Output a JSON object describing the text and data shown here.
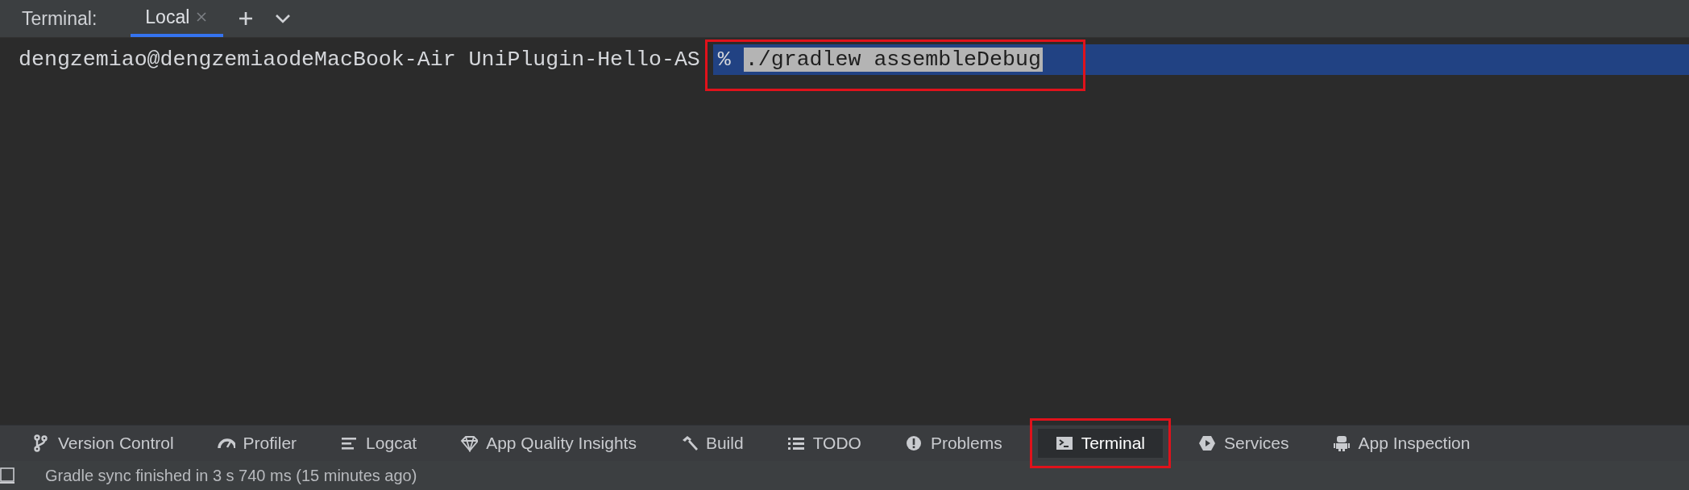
{
  "tool_window": {
    "title": "Terminal:",
    "tabs": [
      {
        "label": "Local",
        "selected": true
      }
    ]
  },
  "terminal": {
    "lines": [
      {
        "prompt": "dengzemiao@dengzemiaodeMacBook-Air UniPlugin-Hello-AS",
        "symbol": "%",
        "command": "./gradlew assembleDebug",
        "current": true,
        "command_selected": true,
        "annotated": true
      }
    ]
  },
  "toolbar": {
    "items": [
      {
        "label": "Version Control",
        "kind": "branch",
        "selected": false,
        "annotated": false
      },
      {
        "label": "Profiler",
        "kind": "gauge",
        "selected": false,
        "annotated": false
      },
      {
        "label": "Logcat",
        "kind": "lines",
        "selected": false,
        "annotated": false
      },
      {
        "label": "App Quality Insights",
        "kind": "diamond",
        "selected": false,
        "annotated": false
      },
      {
        "label": "Build",
        "kind": "hammer",
        "selected": false,
        "annotated": false
      },
      {
        "label": "TODO",
        "kind": "list",
        "selected": false,
        "annotated": false
      },
      {
        "label": "Problems",
        "kind": "alert",
        "selected": false,
        "annotated": false
      },
      {
        "label": "Terminal",
        "kind": "terminal",
        "selected": true,
        "annotated": true
      },
      {
        "label": "Services",
        "kind": "play",
        "selected": false,
        "annotated": false
      },
      {
        "label": "App Inspection",
        "kind": "robot",
        "selected": false,
        "annotated": false
      }
    ]
  },
  "status_bar": {
    "text": "Gradle sync finished in 3 s 740 ms (15 minutes ago)"
  }
}
